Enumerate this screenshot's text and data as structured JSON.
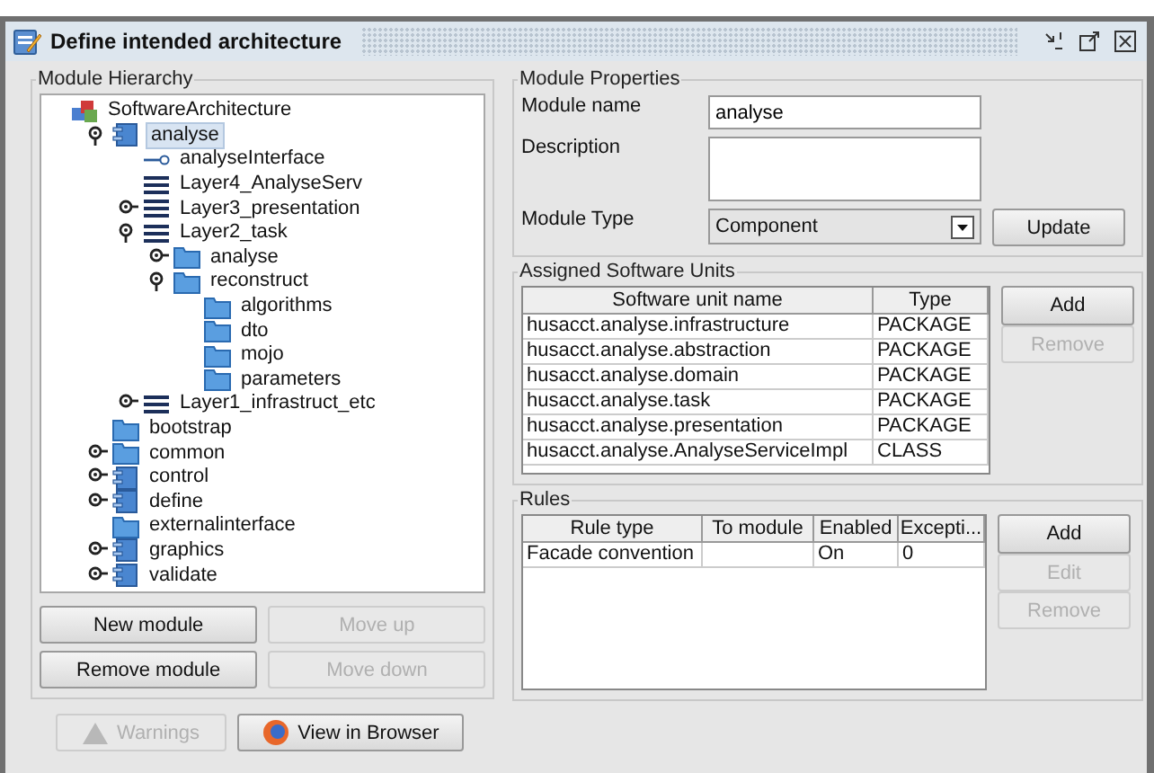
{
  "window": {
    "title": "Define intended architecture"
  },
  "hierarchy": {
    "title": "Module Hierarchy",
    "tree": [
      {
        "label": "SoftwareArchitecture",
        "kind": "root",
        "selected": false,
        "children": [
          {
            "label": "analyse",
            "kind": "component",
            "selected": true,
            "expanded": true,
            "children": [
              {
                "label": "analyseInterface",
                "kind": "interface",
                "selected": false
              },
              {
                "label": "Layer4_AnalyseServ",
                "kind": "layer",
                "selected": false
              },
              {
                "label": "Layer3_presentation",
                "kind": "layer",
                "selected": false,
                "expanded": false
              },
              {
                "label": "Layer2_task",
                "kind": "layer",
                "selected": false,
                "expanded": true,
                "children": [
                  {
                    "label": "analyse",
                    "kind": "folder",
                    "selected": false,
                    "expanded": false
                  },
                  {
                    "label": "reconstruct",
                    "kind": "folder",
                    "selected": false,
                    "expanded": true,
                    "children": [
                      {
                        "label": "algorithms",
                        "kind": "folder",
                        "selected": false
                      },
                      {
                        "label": "dto",
                        "kind": "folder",
                        "selected": false
                      },
                      {
                        "label": "mojo",
                        "kind": "folder",
                        "selected": false
                      },
                      {
                        "label": "parameters",
                        "kind": "folder",
                        "selected": false
                      }
                    ]
                  }
                ]
              },
              {
                "label": "Layer1_infrastruct_etc",
                "kind": "layer",
                "selected": false,
                "expanded": false
              }
            ]
          },
          {
            "label": "bootstrap",
            "kind": "folder",
            "selected": false
          },
          {
            "label": "common",
            "kind": "folder",
            "selected": false,
            "expanded": false
          },
          {
            "label": "control",
            "kind": "component",
            "selected": false,
            "expanded": false
          },
          {
            "label": "define",
            "kind": "component",
            "selected": false,
            "expanded": false
          },
          {
            "label": "externalinterface",
            "kind": "folder",
            "selected": false
          },
          {
            "label": "graphics",
            "kind": "component",
            "selected": false,
            "expanded": false
          },
          {
            "label": "validate",
            "kind": "component",
            "selected": false,
            "expanded": false
          }
        ]
      }
    ],
    "buttons": [
      {
        "label": "New module",
        "disabled": false
      },
      {
        "label": "Move up",
        "disabled": true
      },
      {
        "label": "Remove module",
        "disabled": false
      },
      {
        "label": "Move down",
        "disabled": true
      }
    ]
  },
  "bottom_buttons": [
    {
      "label": "Warnings",
      "kind": "warning",
      "disabled": true
    },
    {
      "label": "View in Browser",
      "kind": "browser",
      "disabled": false
    }
  ],
  "properties": {
    "title": "Module Properties",
    "name_label": "Module name",
    "name_value": "analyse",
    "description_label": "Description",
    "type_label": "Module Type",
    "type_value": "Component",
    "update_button": "Update"
  },
  "units": {
    "title": "Assigned Software Units",
    "columns": [
      "Software unit name",
      "Type"
    ],
    "rows": [
      [
        "husacct.analyse.infrastructure",
        "PACKAGE"
      ],
      [
        "husacct.analyse.abstraction",
        "PACKAGE"
      ],
      [
        "husacct.analyse.domain",
        "PACKAGE"
      ],
      [
        "husacct.analyse.task",
        "PACKAGE"
      ],
      [
        "husacct.analyse.presentation",
        "PACKAGE"
      ],
      [
        "husacct.analyse.AnalyseServiceImpl",
        "CLASS"
      ]
    ],
    "buttons": [
      {
        "label": "Add",
        "disabled": false
      },
      {
        "label": "Remove",
        "disabled": true
      }
    ]
  },
  "rules": {
    "title": "Rules",
    "columns": [
      "Rule type",
      "To module",
      "Enabled",
      "Excepti..."
    ],
    "rows": [
      [
        "Facade convention",
        "",
        "On",
        "0"
      ]
    ],
    "buttons": [
      {
        "label": "Add",
        "disabled": false
      },
      {
        "label": "Edit",
        "disabled": true
      },
      {
        "label": "Remove",
        "disabled": true
      }
    ]
  }
}
